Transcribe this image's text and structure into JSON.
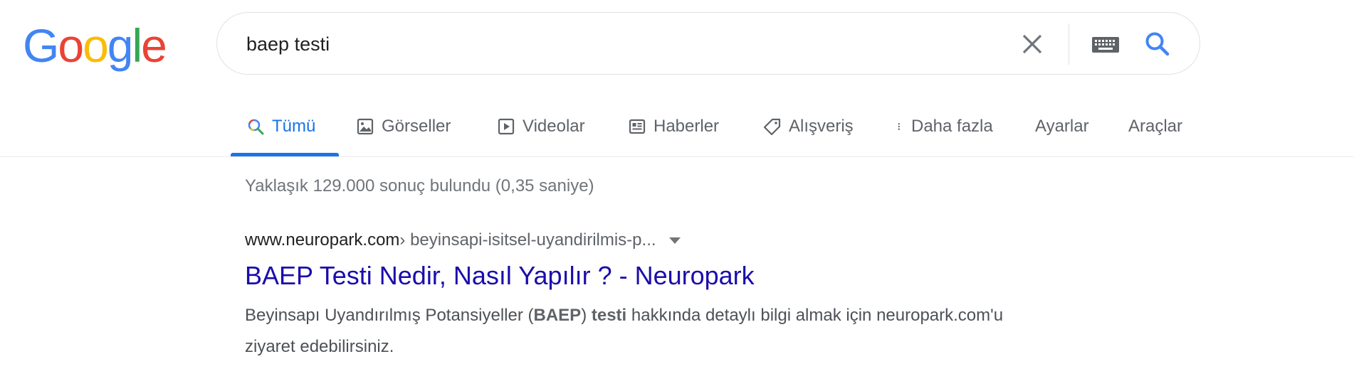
{
  "logo": {
    "letters": [
      "G",
      "o",
      "o",
      "g",
      "l",
      "e"
    ],
    "colors": [
      "#4285F4",
      "#EA4335",
      "#FBBC05",
      "#4285F4",
      "#34A853",
      "#EA4335"
    ]
  },
  "search": {
    "query": "baep testi",
    "clear_icon": "close-icon",
    "keyboard_icon": "keyboard-icon",
    "search_icon": "search-icon"
  },
  "tabs": [
    {
      "label": "Tümü",
      "icon": "search-icon",
      "active": true
    },
    {
      "label": "Görseller",
      "icon": "image-icon",
      "active": false
    },
    {
      "label": "Videolar",
      "icon": "play-icon",
      "active": false
    },
    {
      "label": "Haberler",
      "icon": "news-icon",
      "active": false
    },
    {
      "label": "Alışveriş",
      "icon": "tag-icon",
      "active": false
    },
    {
      "label": "Daha fazla",
      "icon": "more-vert-icon",
      "active": false
    },
    {
      "label": "Ayarlar",
      "icon": "",
      "active": false
    },
    {
      "label": "Araçlar",
      "icon": "",
      "active": false
    }
  ],
  "results": {
    "stats": "Yaklaşık 129.000 sonuç bulundu (0,35 saniye)",
    "items": [
      {
        "domain": "www.neuropark.com",
        "path": " › beyinsapi-isitsel-uyandirilmis-p...",
        "title": "BAEP Testi Nedir, Nasıl Yapılır ? - Neuropark",
        "snippet_parts": [
          {
            "text": "Beyinsapı Uyandırılmış Potansiyeller (",
            "bold": false
          },
          {
            "text": "BAEP",
            "bold": true
          },
          {
            "text": ") ",
            "bold": false
          },
          {
            "text": "testi",
            "bold": true
          },
          {
            "text": " hakkında detaylı bilgi almak için neuropark.com'u ziyaret edebilirsiniz.",
            "bold": false
          }
        ]
      }
    ]
  },
  "colors": {
    "accent": "#1a73e8",
    "link": "#1a0dab",
    "muted": "#70757a"
  }
}
